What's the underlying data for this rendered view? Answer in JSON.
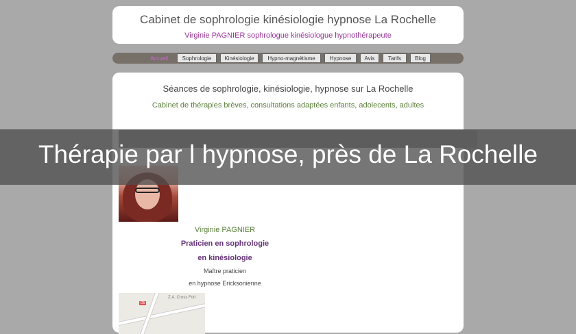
{
  "header": {
    "title": "Cabinet de sophrologie kinésiologie hypnose La Rochelle",
    "subtitle": "Virginie PAGNIER sophrologue kinésiologue hypnothérapeute"
  },
  "nav": {
    "items": [
      {
        "label": "Accueil",
        "active": true
      },
      {
        "label": "Sophrologie"
      },
      {
        "label": "Kinésiologie"
      },
      {
        "label": "Hypno-magnétisme"
      },
      {
        "label": "Hypnose"
      },
      {
        "label": "Avis"
      },
      {
        "label": "Tarifs"
      },
      {
        "label": "Blog"
      }
    ]
  },
  "content": {
    "title": "Séances de sophrologie, kinésiologie, hypnose sur La Rochelle",
    "subtitle": "Cabinet de thérapies brèves, consultations adaptées enfants, adolecents, adultes"
  },
  "bio": {
    "name": "Virginie PAGNIER",
    "role1": "Praticien en sophrologie",
    "role2": "en kinésiologie",
    "line3": "Maître praticien",
    "line4": "en hypnose Ericksonienne"
  },
  "map": {
    "label": "Z.A. Cross Fort",
    "badge": "D5"
  },
  "overlay": {
    "caption": "Thérapie par l hypnose, près de La Rochelle"
  },
  "colors": {
    "accent_purple": "#993399",
    "accent_green": "#5a7f3a",
    "nav_bg": "#777068"
  }
}
